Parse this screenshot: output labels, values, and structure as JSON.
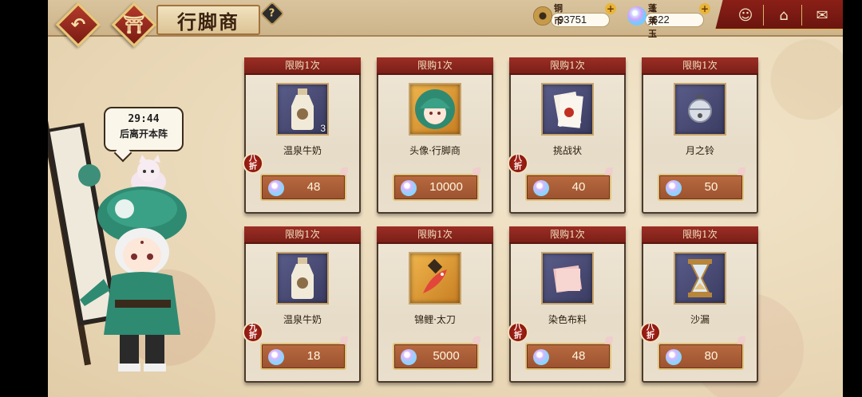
{
  "header": {
    "back_icon": "back-arrow-icon",
    "home_icon": "torii-gate-icon",
    "title": "行脚商",
    "help_label": "?"
  },
  "currencies": {
    "coins": {
      "name": "铜币",
      "value": "93751",
      "plus": "+"
    },
    "jade": {
      "name": "蓬莱玉",
      "value": "622",
      "plus": "+"
    }
  },
  "utility_icons": [
    "character-icon",
    "home-upgrade-icon",
    "mail-icon"
  ],
  "merchant": {
    "timer": "29:44",
    "timer_text": "后离开本阵"
  },
  "items": [
    {
      "limit": "限购1次",
      "name": "温泉牛奶",
      "qty": "3",
      "price": "48",
      "discount": "八折",
      "icon": "milk-bottle-icon"
    },
    {
      "limit": "限购1次",
      "name": "头像·行脚商",
      "qty": "",
      "price": "10000",
      "discount": "",
      "icon": "merchant-avatar-icon"
    },
    {
      "limit": "限购1次",
      "name": "挑战状",
      "qty": "",
      "price": "40",
      "discount": "八折",
      "icon": "challenge-letter-icon"
    },
    {
      "limit": "限购1次",
      "name": "月之铃",
      "qty": "",
      "price": "50",
      "discount": "",
      "icon": "moon-bell-icon"
    },
    {
      "limit": "限购1次",
      "name": "温泉牛奶",
      "qty": "",
      "price": "18",
      "discount": "九折",
      "icon": "milk-bottle-icon"
    },
    {
      "limit": "限购1次",
      "name": "锦鲤·太刀",
      "qty": "",
      "price": "5000",
      "discount": "",
      "icon": "koi-katana-icon"
    },
    {
      "limit": "限购1次",
      "name": "染色布料",
      "qty": "",
      "price": "48",
      "discount": "八折",
      "icon": "dye-cloth-icon"
    },
    {
      "limit": "限购1次",
      "name": "沙漏",
      "qty": "",
      "price": "80",
      "discount": "八折",
      "icon": "hourglass-icon"
    }
  ]
}
